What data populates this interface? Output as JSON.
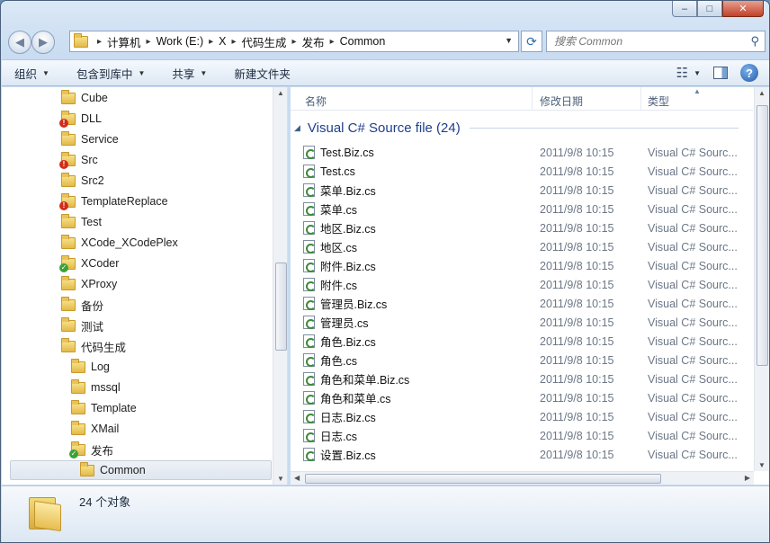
{
  "window": {
    "minimize_glyph": "‒",
    "maximize_glyph": "□",
    "close_glyph": "✕"
  },
  "nav": {
    "back_glyph": "◀",
    "forward_glyph": "▶",
    "breadcrumbs": [
      "计算机",
      "Work (E:)",
      "X",
      "代码生成",
      "发布",
      "Common"
    ],
    "search_placeholder": "搜索 Common"
  },
  "toolbar": {
    "organize": "组织",
    "include_library": "包含到库中",
    "share": "共享",
    "new_folder": "新建文件夹"
  },
  "tree": [
    {
      "label": "Cube",
      "badge": ""
    },
    {
      "label": "DLL",
      "badge": "err"
    },
    {
      "label": "Service",
      "badge": ""
    },
    {
      "label": "Src",
      "badge": "err"
    },
    {
      "label": "Src2",
      "badge": ""
    },
    {
      "label": "TemplateReplace",
      "badge": "err"
    },
    {
      "label": "Test",
      "badge": ""
    },
    {
      "label": "XCode_XCodePlex",
      "badge": ""
    },
    {
      "label": "XCoder",
      "badge": "ok"
    },
    {
      "label": "XProxy",
      "badge": ""
    },
    {
      "label": "备份",
      "badge": ""
    },
    {
      "label": "测试",
      "badge": ""
    },
    {
      "label": "代码生成",
      "badge": ""
    },
    {
      "label": "Log",
      "badge": ""
    },
    {
      "label": "mssql",
      "badge": ""
    },
    {
      "label": "Template",
      "badge": ""
    },
    {
      "label": "XMail",
      "badge": ""
    },
    {
      "label": "发布",
      "badge": "ok"
    },
    {
      "label": "Common",
      "badge": ""
    }
  ],
  "columns": {
    "name": "名称",
    "modified": "修改日期",
    "type": "类型"
  },
  "group": {
    "title": "Visual C# Source file (24)"
  },
  "files": [
    {
      "name": "Test.Biz.cs",
      "date": "2011/9/8 10:15",
      "type": "Visual C# Sourc..."
    },
    {
      "name": "Test.cs",
      "date": "2011/9/8 10:15",
      "type": "Visual C# Sourc..."
    },
    {
      "name": "菜单.Biz.cs",
      "date": "2011/9/8 10:15",
      "type": "Visual C# Sourc..."
    },
    {
      "name": "菜单.cs",
      "date": "2011/9/8 10:15",
      "type": "Visual C# Sourc..."
    },
    {
      "name": "地区.Biz.cs",
      "date": "2011/9/8 10:15",
      "type": "Visual C# Sourc..."
    },
    {
      "name": "地区.cs",
      "date": "2011/9/8 10:15",
      "type": "Visual C# Sourc..."
    },
    {
      "name": "附件.Biz.cs",
      "date": "2011/9/8 10:15",
      "type": "Visual C# Sourc..."
    },
    {
      "name": "附件.cs",
      "date": "2011/9/8 10:15",
      "type": "Visual C# Sourc..."
    },
    {
      "name": "管理员.Biz.cs",
      "date": "2011/9/8 10:15",
      "type": "Visual C# Sourc..."
    },
    {
      "name": "管理员.cs",
      "date": "2011/9/8 10:15",
      "type": "Visual C# Sourc..."
    },
    {
      "name": "角色.Biz.cs",
      "date": "2011/9/8 10:15",
      "type": "Visual C# Sourc..."
    },
    {
      "name": "角色.cs",
      "date": "2011/9/8 10:15",
      "type": "Visual C# Sourc..."
    },
    {
      "name": "角色和菜单.Biz.cs",
      "date": "2011/9/8 10:15",
      "type": "Visual C# Sourc..."
    },
    {
      "name": "角色和菜单.cs",
      "date": "2011/9/8 10:15",
      "type": "Visual C# Sourc..."
    },
    {
      "name": "日志.Biz.cs",
      "date": "2011/9/8 10:15",
      "type": "Visual C# Sourc..."
    },
    {
      "name": "日志.cs",
      "date": "2011/9/8 10:15",
      "type": "Visual C# Sourc..."
    },
    {
      "name": "设置.Biz.cs",
      "date": "2011/9/8 10:15",
      "type": "Visual C# Sourc..."
    }
  ],
  "details": {
    "count_text": "24 个对象"
  },
  "icons": {
    "folder": "folder-icon",
    "cs_file": "csharp-file-icon",
    "search": "search-icon",
    "refresh": "refresh-icon",
    "help": "help-icon"
  }
}
